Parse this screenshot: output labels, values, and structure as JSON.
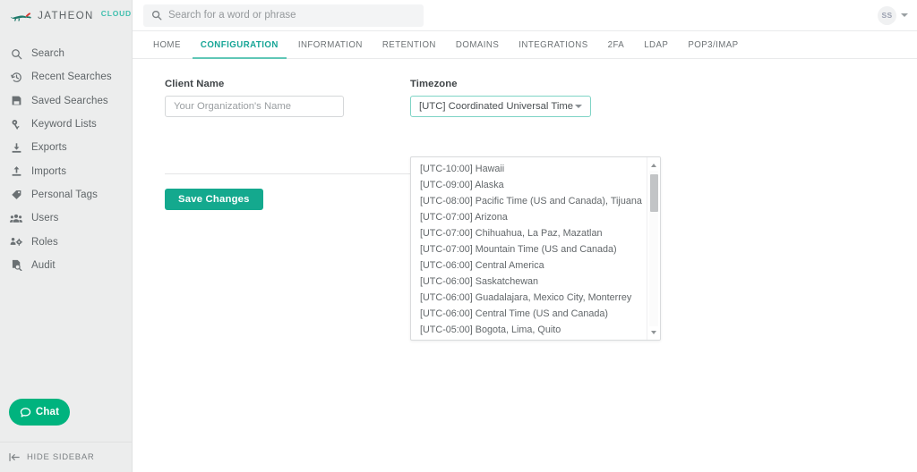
{
  "brand": {
    "name": "JATHEON",
    "suffix": "CLOUD",
    "logo_icon": "fox-logo-icon"
  },
  "search": {
    "placeholder": "Search for a word or phrase",
    "value": "",
    "icon": "search-icon"
  },
  "account": {
    "initials": "SS",
    "caret_icon": "chevron-down-icon"
  },
  "sidebar": {
    "items": [
      {
        "label": "Search",
        "icon": "search-icon"
      },
      {
        "label": "Recent Searches",
        "icon": "history-clock-icon"
      },
      {
        "label": "Saved Searches",
        "icon": "floppy-disk-icon"
      },
      {
        "label": "Keyword Lists",
        "icon": "key-icon"
      },
      {
        "label": "Exports",
        "icon": "download-icon"
      },
      {
        "label": "Imports",
        "icon": "upload-icon"
      },
      {
        "label": "Personal Tags",
        "icon": "tag-icon"
      },
      {
        "label": "Users",
        "icon": "users-icon"
      },
      {
        "label": "Roles",
        "icon": "roles-gear-people-icon"
      },
      {
        "label": "Audit",
        "icon": "audit-document-search-icon"
      }
    ],
    "chat": {
      "label": "Chat",
      "icon": "chat-bubble-icon"
    },
    "hide": {
      "label": "HIDE SIDEBAR",
      "icon": "collapse-left-icon"
    }
  },
  "tabs": [
    {
      "label": "HOME",
      "active": false
    },
    {
      "label": "CONFIGURATION",
      "active": true
    },
    {
      "label": "INFORMATION",
      "active": false
    },
    {
      "label": "RETENTION",
      "active": false
    },
    {
      "label": "DOMAINS",
      "active": false
    },
    {
      "label": "INTEGRATIONS",
      "active": false
    },
    {
      "label": "2FA",
      "active": false
    },
    {
      "label": "LDAP",
      "active": false
    },
    {
      "label": "POP3/IMAP",
      "active": false
    }
  ],
  "form": {
    "client_name": {
      "label": "Client Name",
      "placeholder": "Your Organization's Name",
      "value": ""
    },
    "timezone": {
      "label": "Timezone",
      "selected": "[UTC] Coordinated Universal Time",
      "caret_icon": "chevron-down-icon",
      "options": [
        "[UTC-10:00] Hawaii",
        "[UTC-09:00] Alaska",
        "[UTC-08:00] Pacific Time (US and Canada), Tijuana",
        "[UTC-07:00] Arizona",
        "[UTC-07:00] Chihuahua, La Paz, Mazatlan",
        "[UTC-07:00] Mountain Time (US and Canada)",
        "[UTC-06:00] Central America",
        "[UTC-06:00] Saskatchewan",
        "[UTC-06:00] Guadalajara, Mexico City, Monterrey",
        "[UTC-06:00] Central Time (US and Canada)",
        "[UTC-05:00] Bogota, Lima, Quito"
      ]
    },
    "save_label": "Save Changes"
  },
  "colors": {
    "brand_teal": "#3fbfae",
    "active_tab": "#16a596",
    "save_button": "#14a98e",
    "chat_green": "#00b37e",
    "sidebar_bg": "#eceded",
    "select_focus_border": "#7fd4c6"
  }
}
